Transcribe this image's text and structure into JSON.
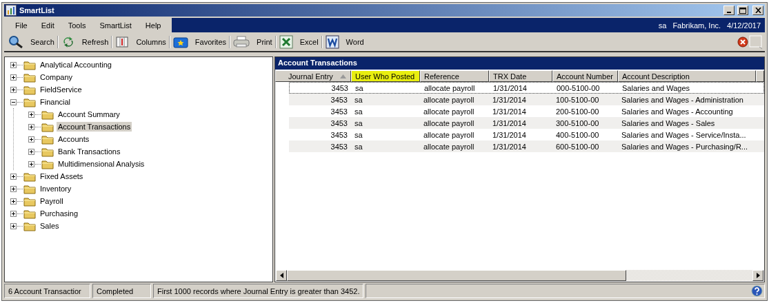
{
  "window": {
    "title": "SmartList"
  },
  "menu": [
    "File",
    "Edit",
    "Tools",
    "SmartList",
    "Help"
  ],
  "session": {
    "user": "sa",
    "company": "Fabrikam, Inc.",
    "date": "4/12/2017"
  },
  "toolbar": [
    {
      "kind": "search",
      "label": "Search"
    },
    {
      "kind": "refresh",
      "label": "Refresh"
    },
    {
      "kind": "columns",
      "label": "Columns"
    },
    {
      "kind": "favorites",
      "label": "Favorites"
    },
    {
      "kind": "print",
      "label": "Print"
    },
    {
      "kind": "excel",
      "label": "Excel"
    },
    {
      "kind": "word",
      "label": "Word"
    }
  ],
  "tree": [
    {
      "label": "Analytical Accounting",
      "expanded": false,
      "selected": false
    },
    {
      "label": "Company",
      "expanded": false,
      "selected": false
    },
    {
      "label": "FieldService",
      "expanded": false,
      "selected": false
    },
    {
      "label": "Financial",
      "expanded": true,
      "selected": false,
      "children": [
        {
          "label": "Account Summary",
          "expanded": false,
          "selected": false
        },
        {
          "label": "Account Transactions",
          "expanded": false,
          "selected": true
        },
        {
          "label": "Accounts",
          "expanded": false,
          "selected": false
        },
        {
          "label": "Bank Transactions",
          "expanded": false,
          "selected": false
        },
        {
          "label": "Multidimensional  Analysis",
          "expanded": false,
          "selected": false
        }
      ]
    },
    {
      "label": "Fixed Assets",
      "expanded": false,
      "selected": false
    },
    {
      "label": "Inventory",
      "expanded": false,
      "selected": false
    },
    {
      "label": "Payroll",
      "expanded": false,
      "selected": false
    },
    {
      "label": "Purchasing",
      "expanded": false,
      "selected": false
    },
    {
      "label": "Sales",
      "expanded": false,
      "selected": false
    }
  ],
  "table": {
    "title": "Account Transactions",
    "columns": [
      {
        "label": "Journal Entry",
        "sorted": true,
        "highlighted": false
      },
      {
        "label": "User Who Posted",
        "sorted": false,
        "highlighted": true
      },
      {
        "label": "Reference",
        "sorted": false,
        "highlighted": false
      },
      {
        "label": "TRX Date",
        "sorted": false,
        "highlighted": false
      },
      {
        "label": "Account Number",
        "sorted": false,
        "highlighted": false
      },
      {
        "label": "Account Description",
        "sorted": false,
        "highlighted": false
      }
    ],
    "rows": [
      {
        "focused": true,
        "cells": [
          "3453",
          "sa",
          "allocate payroll",
          "1/31/2014",
          "000-5100-00",
          "Salaries and Wages"
        ]
      },
      {
        "focused": false,
        "cells": [
          "3453",
          "sa",
          "allocate payroll",
          "1/31/2014",
          "100-5100-00",
          "Salaries and Wages - Administration"
        ]
      },
      {
        "focused": false,
        "cells": [
          "3453",
          "sa",
          "allocate payroll",
          "1/31/2014",
          "200-5100-00",
          "Salaries and Wages - Accounting"
        ]
      },
      {
        "focused": false,
        "cells": [
          "3453",
          "sa",
          "allocate payroll",
          "1/31/2014",
          "300-5100-00",
          "Salaries and Wages - Sales"
        ]
      },
      {
        "focused": false,
        "cells": [
          "3453",
          "sa",
          "allocate payroll",
          "1/31/2014",
          "400-5100-00",
          "Salaries and Wages - Service/Insta..."
        ]
      },
      {
        "focused": false,
        "cells": [
          "3453",
          "sa",
          "allocate payroll",
          "1/31/2014",
          "600-5100-00",
          "Salaries and Wages - Purchasing/R..."
        ]
      }
    ]
  },
  "status_bar": [
    "6 Account Transactior",
    "Completed",
    "First 1000 records where Journal Entry is greater than 3452."
  ]
}
